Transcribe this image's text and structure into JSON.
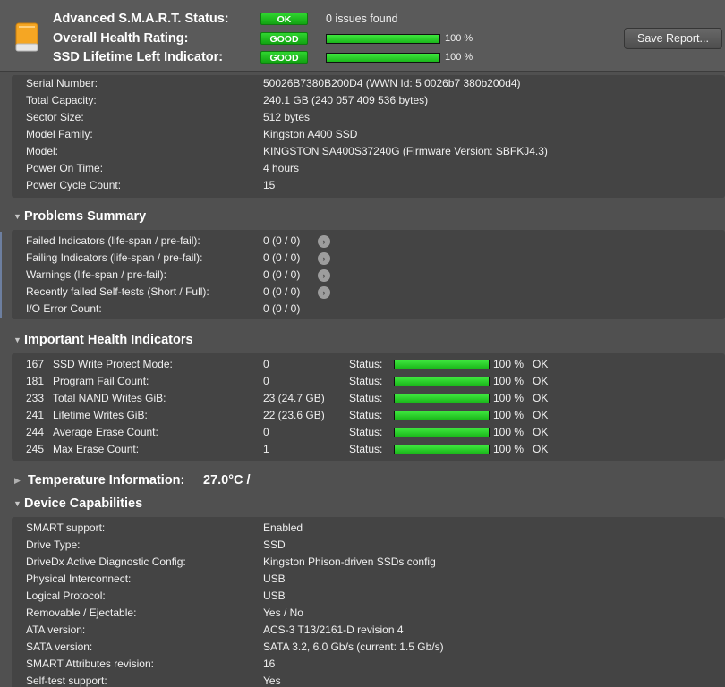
{
  "header": {
    "smart_status_label": "Advanced S.M.A.R.T. Status:",
    "smart_status_badge": "OK",
    "smart_status_text": "0 issues found",
    "health_label": "Overall Health Rating:",
    "health_badge": "GOOD",
    "health_value": 1.0,
    "health_pct": "100 %",
    "lifetime_label": "SSD Lifetime Left Indicator:",
    "lifetime_badge": "GOOD",
    "lifetime_value": 1.0,
    "lifetime_pct": "100 %",
    "save_report_label": "Save Report..."
  },
  "device_info": [
    {
      "key": "Serial Number:",
      "value": "50026B7380B200D4 (WWN Id: 5 0026b7 380b200d4)"
    },
    {
      "key": "Total Capacity:",
      "value": "240.1 GB (240 057 409 536 bytes)"
    },
    {
      "key": "Sector Size:",
      "value": "512 bytes"
    },
    {
      "key": "Model Family:",
      "value": "Kingston A400 SSD"
    },
    {
      "key": "Model:",
      "value": "KINGSTON SA400S37240G  (Firmware Version: SBFKJ4.3)"
    },
    {
      "key": "Power On Time:",
      "value": "4 hours"
    },
    {
      "key": "Power Cycle Count:",
      "value": "15"
    }
  ],
  "problems": {
    "title": "Problems Summary",
    "rows": [
      {
        "key": "Failed Indicators (life-span / pre-fail):",
        "value": "0 (0 / 0)"
      },
      {
        "key": "Failing Indicators (life-span / pre-fail):",
        "value": "0 (0 / 0)"
      },
      {
        "key": "Warnings (life-span / pre-fail):",
        "value": "0 (0 / 0)"
      },
      {
        "key": "Recently failed Self-tests (Short / Full):",
        "value": "0 (0 / 0)"
      },
      {
        "key": "I/O Error Count:",
        "value": "0 (0 / 0)"
      }
    ]
  },
  "health_indicators": {
    "title": "Important Health Indicators",
    "status_label": "Status:",
    "rows": [
      {
        "id": "167",
        "name": "SSD Write Protect Mode:",
        "value": "0",
        "level": 1.0,
        "pct": "100 %",
        "state": "OK"
      },
      {
        "id": "181",
        "name": "Program Fail Count:",
        "value": "0",
        "level": 1.0,
        "pct": "100 %",
        "state": "OK"
      },
      {
        "id": "233",
        "name": "Total NAND Writes GiB:",
        "value": "23 (24.7 GB)",
        "level": 1.0,
        "pct": "100 %",
        "state": "OK"
      },
      {
        "id": "241",
        "name": "Lifetime Writes GiB:",
        "value": "22 (23.6 GB)",
        "level": 1.0,
        "pct": "100 %",
        "state": "OK"
      },
      {
        "id": "244",
        "name": "Average Erase Count:",
        "value": "0",
        "level": 1.0,
        "pct": "100 %",
        "state": "OK"
      },
      {
        "id": "245",
        "name": "Max Erase Count:",
        "value": "1",
        "level": 1.0,
        "pct": "100 %",
        "state": "OK"
      }
    ]
  },
  "temperature": {
    "title": "Temperature Information:",
    "value": "27.0°C /"
  },
  "capabilities": {
    "title": "Device Capabilities",
    "rows": [
      {
        "key": "SMART support:",
        "value": "Enabled"
      },
      {
        "key": "Drive Type:",
        "value": "SSD"
      },
      {
        "key": "DriveDx Active Diagnostic Config:",
        "value": "Kingston Phison-driven SSDs config"
      },
      {
        "key": "Physical Interconnect:",
        "value": "USB"
      },
      {
        "key": "Logical Protocol:",
        "value": "USB"
      },
      {
        "key": "Removable / Ejectable:",
        "value": "Yes / No"
      },
      {
        "key": "ATA version:",
        "value": "ACS-3 T13/2161-D revision 4"
      },
      {
        "key": "SATA version:",
        "value": "SATA 3.2, 6.0 Gb/s (current: 1.5 Gb/s)"
      },
      {
        "key": "SMART Attributes revision:",
        "value": "16"
      },
      {
        "key": "Self-test support:",
        "value": "Yes"
      }
    ]
  },
  "colors": {
    "ok_green": "#1fc21f",
    "bar_green": "#2ddc2d",
    "background": "#505050",
    "panel": "#444444"
  }
}
